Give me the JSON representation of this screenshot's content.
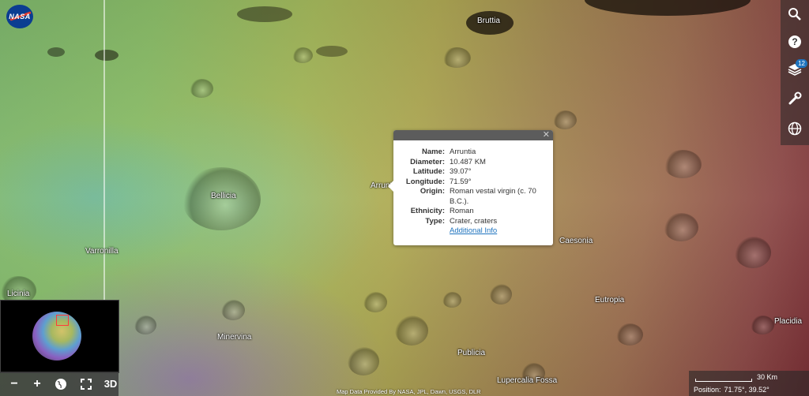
{
  "logo": {
    "text": "NASA"
  },
  "toolbar": {
    "items": [
      {
        "name": "search",
        "icon": "search-icon"
      },
      {
        "name": "help",
        "icon": "question-icon"
      },
      {
        "name": "layers",
        "icon": "layers-icon",
        "badge": "12"
      },
      {
        "name": "tools",
        "icon": "wrench-icon"
      },
      {
        "name": "projection",
        "icon": "globe-icon"
      }
    ]
  },
  "places": {
    "bruttia": "Bruttia",
    "bellicia": "Bellicia",
    "varronilla": "Varronilla",
    "licinia": "Licinia",
    "minervina": "Minervina",
    "arruntia": "Arruntia",
    "caesonia": "Caesonia",
    "eutropia": "Eutropia",
    "placidia": "Placidia",
    "publicia": "Publicia",
    "lupercalia": "Lupercalia Fossa"
  },
  "popup": {
    "close": "✕",
    "rows": [
      {
        "key": "Name:",
        "value": "Arruntia"
      },
      {
        "key": "Diameter:",
        "value": "10.487 KM"
      },
      {
        "key": "Latitude:",
        "value": "39.07°"
      },
      {
        "key": "Longitude:",
        "value": "71.59°"
      },
      {
        "key": "Origin:",
        "value": "Roman vestal virgin (c. 70 B.C.)."
      },
      {
        "key": "Ethnicity:",
        "value": "Roman"
      },
      {
        "key": "Type:",
        "value": "Crater, craters"
      }
    ],
    "link": "Additional Info"
  },
  "nav": {
    "zoom_out": "−",
    "zoom_in": "+",
    "globe": "globe-icon",
    "fullscreen": "fullscreen-icon",
    "mode": "3D"
  },
  "attribution": "Map Data Provided By NASA, JPL, Dawn, USGS, DLR",
  "scale": {
    "label": "30 Km"
  },
  "position": {
    "label": "Position:",
    "value": "71.75°, 39.52°"
  }
}
